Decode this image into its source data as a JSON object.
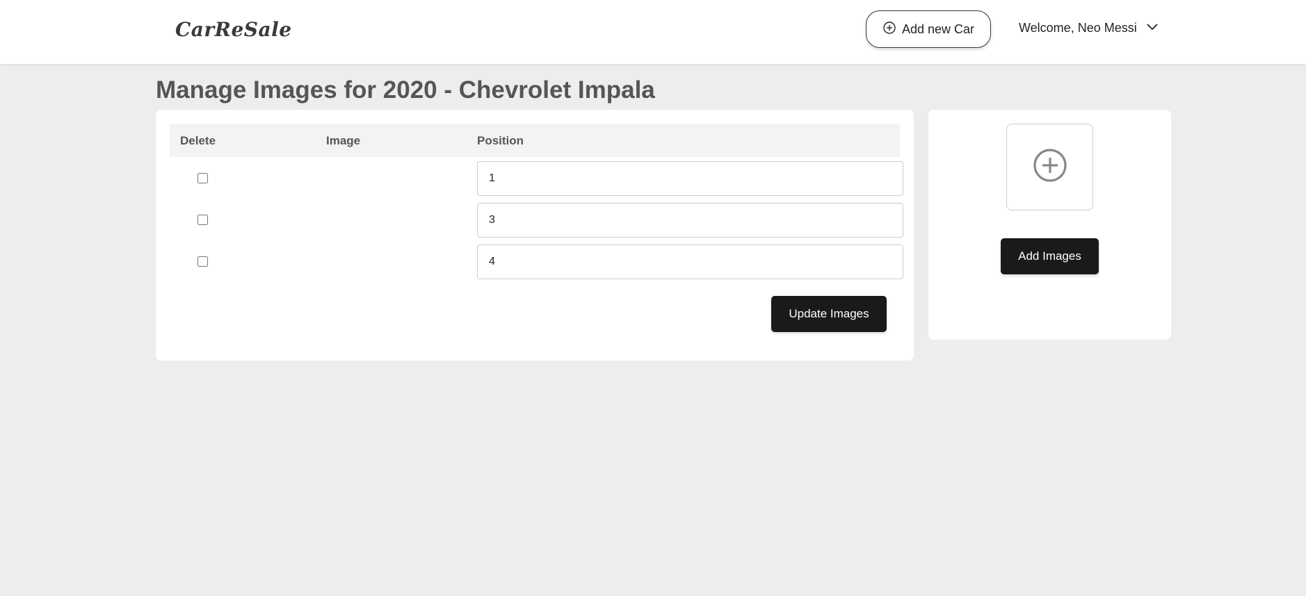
{
  "navbar": {
    "brand": "CarReSale",
    "add_car_label": "Add new Car",
    "add_car_icon": "plus-circle-icon",
    "welcome_text": "Welcome, Neo Messi",
    "welcome_icon": "chevron-down-icon"
  },
  "page": {
    "title": "Manage Images for 2020 - Chevrolet Impala"
  },
  "images_table": {
    "columns": [
      "Delete",
      "Image",
      "Position"
    ],
    "rows": [
      {
        "delete_checked": false,
        "position": "1"
      },
      {
        "delete_checked": false,
        "position": "3"
      },
      {
        "delete_checked": false,
        "position": "4"
      }
    ],
    "update_label": "Update Images"
  },
  "upload_panel": {
    "upload_icon": "plus-circle-icon",
    "add_images_label": "Add Images"
  },
  "colors": {
    "page_bg": "#ededed",
    "button_bg": "#1b1a18",
    "title_color": "#555555"
  }
}
